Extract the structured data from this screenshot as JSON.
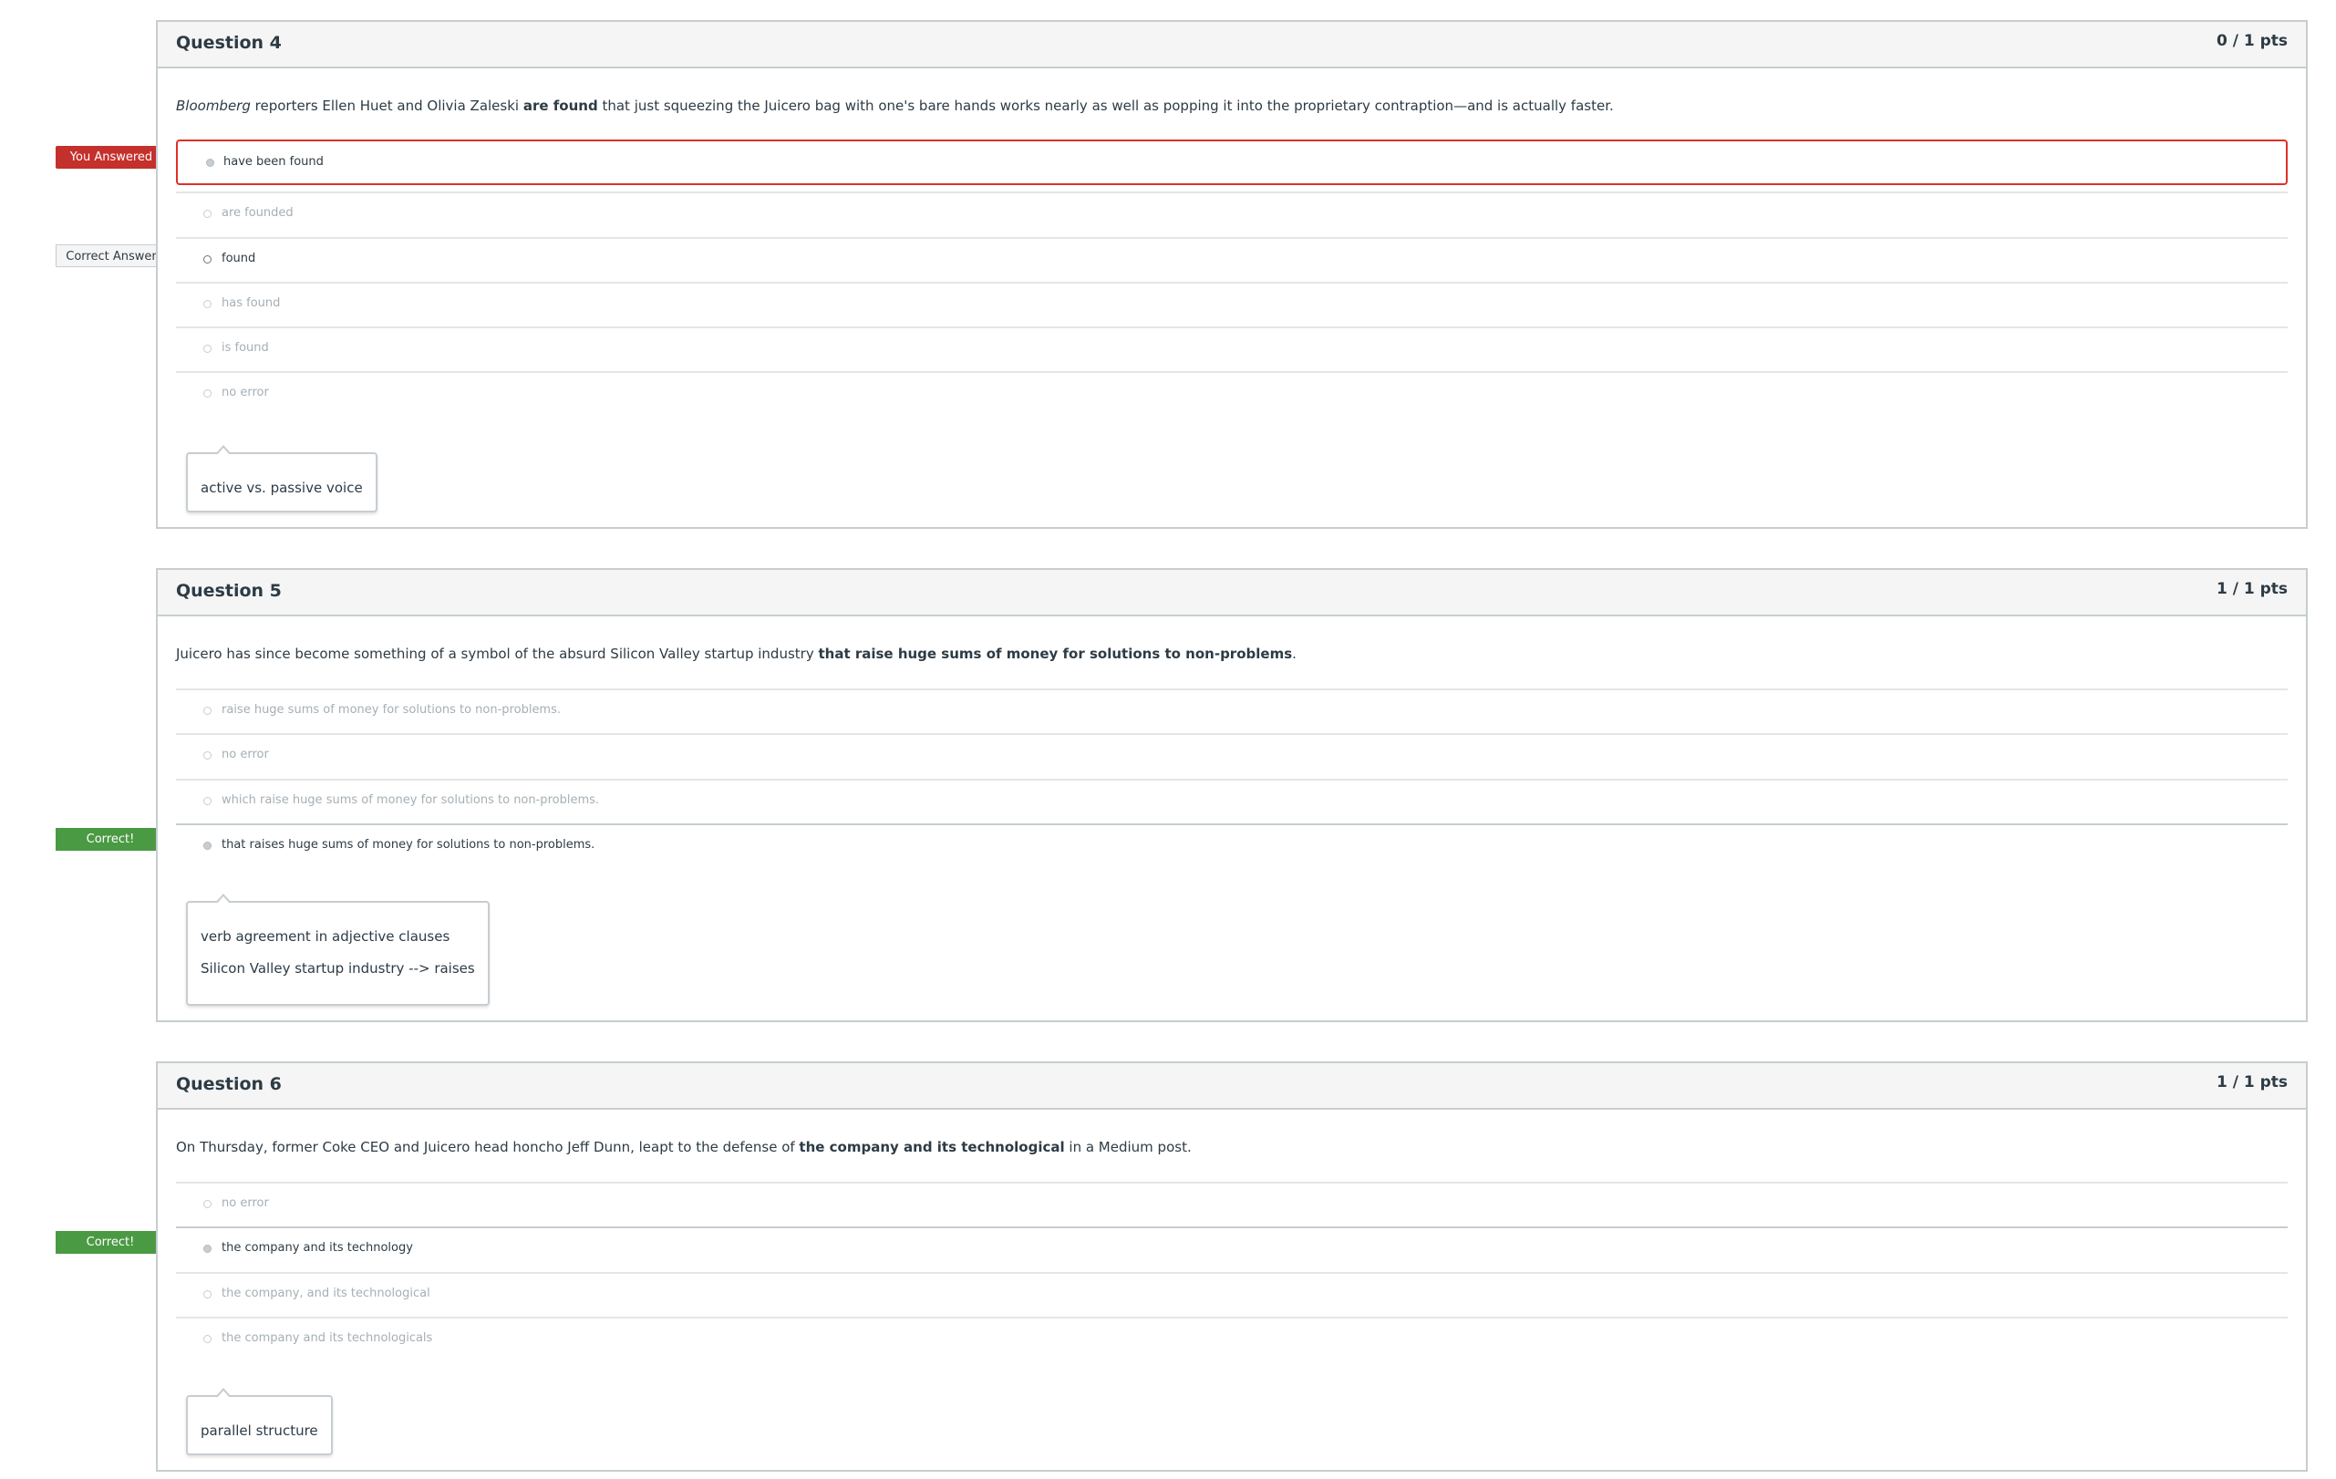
{
  "questions": [
    {
      "title": "Question 4",
      "points": "0 / 1 pts",
      "text_parts": {
        "italic": "Bloomberg",
        "pre": " reporters Ellen Huet and Olivia Zaleski ",
        "bold": "are found",
        "post": " that just squeezing the Juicero bag with one's bare hands works nearly as well as popping it into the proprietary contraption—and is actually faster."
      },
      "answers": [
        "have been found",
        "are founded",
        "found",
        "has found",
        "is found",
        "no error"
      ],
      "selected_index": 0,
      "correct_index": 2,
      "comments": [
        "active vs. passive voice"
      ],
      "flags": {
        "you_answered": "You Answered",
        "correct_answer": "Correct Answer"
      }
    },
    {
      "title": "Question 5",
      "points": "1 / 1 pts",
      "text_parts": {
        "pre": "Juicero has since become something of a symbol of the absurd Silicon Valley startup industry ",
        "bold": "that raise huge sums of money for solutions to non-problems",
        "post": "."
      },
      "answers": [
        "raise huge sums of money for solutions to non-problems.",
        "no error",
        "which raise huge sums of money for solutions to non-problems.",
        "that raises huge sums of money for solutions to non-problems."
      ],
      "selected_index": 3,
      "comments": [
        "verb agreement in adjective clauses",
        "Silicon Valley startup industry --> raises"
      ],
      "flags": {
        "correct": "Correct!"
      }
    },
    {
      "title": "Question 6",
      "points": "1 / 1 pts",
      "text_parts": {
        "pre": "On Thursday, former Coke CEO and Juicero head honcho Jeff Dunn, leapt to the defense of ",
        "bold": "the company and its technological",
        "post": " in a Medium post."
      },
      "answers": [
        "no error",
        "the company and its technology",
        "the company, and its technological",
        "the company and its technologicals"
      ],
      "selected_index": 1,
      "comments": [
        "parallel structure"
      ],
      "flags": {
        "correct": "Correct!"
      }
    }
  ],
  "colors": {
    "wrong_flag": "#c4302b",
    "correct_flag": "#4a9a43",
    "border": "#c7cdd1",
    "header_bg": "#f5f5f5",
    "text": "#2d3b45",
    "muted_text": "#a5afb5"
  }
}
